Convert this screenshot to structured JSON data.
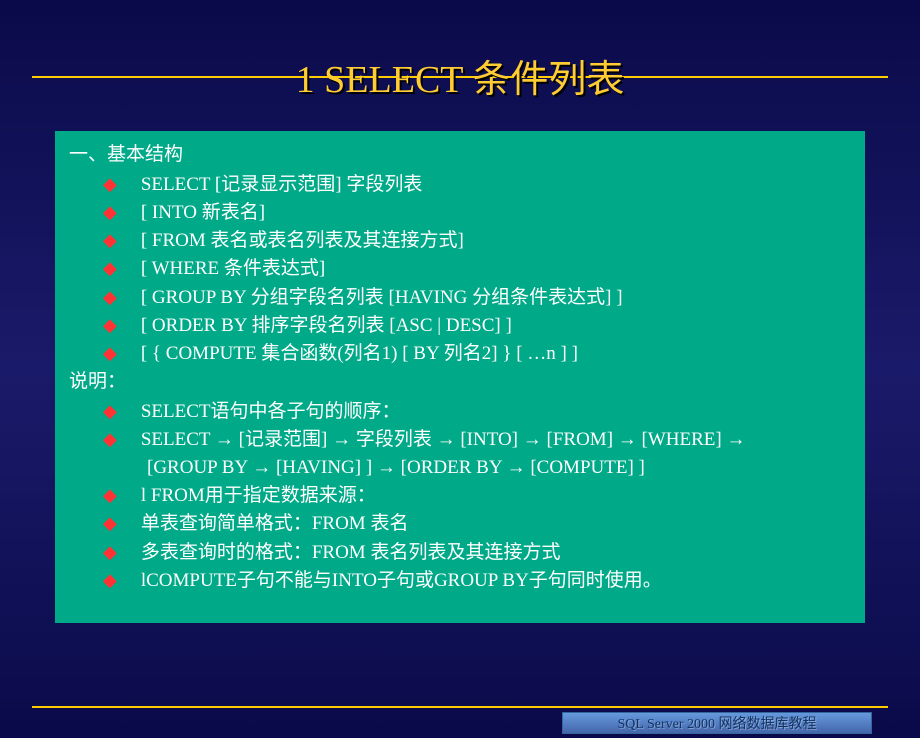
{
  "title": "1  SELECT 条件列表",
  "section1_header": "一、基本结构",
  "section1_items": [
    "SELECT  [记录显示范围]  字段列表",
    " [ INTO 新表名]",
    " [ FROM  表名或表名列表及其连接方式]",
    " [ WHERE 条件表达式]",
    " [ GROUP BY 分组字段名列表 [HAVING 分组条件表达式] ]",
    " [ ORDER BY  排序字段名列表 [ASC | DESC] ]",
    " [ { COMPUTE 集合函数(列名1) [ BY 列名2] } [ …n ] ]"
  ],
  "section2_header": "说明：",
  "section2_items": [
    {
      "text": " SELECT语句中各子句的顺序：",
      "cont": null
    },
    {
      "text": "   SELECT → [记录范围] → 字段列表 → [INTO] → [FROM] → [WHERE] →",
      "cont": "[GROUP BY → [HAVING] ] → [ORDER BY → [COMPUTE] ]"
    },
    {
      "text": "l FROM用于指定数据来源：",
      "cont": null
    },
    {
      "text": "   单表查询简单格式：FROM  表名",
      "cont": null
    },
    {
      "text": "   多表查询时的格式：FROM  表名列表及其连接方式",
      "cont": null
    },
    {
      "text": "lCOMPUTE子句不能与INTO子句或GROUP BY子句同时使用。",
      "cont": null
    }
  ],
  "footer": "SQL Server 2000 网络数据库教程"
}
